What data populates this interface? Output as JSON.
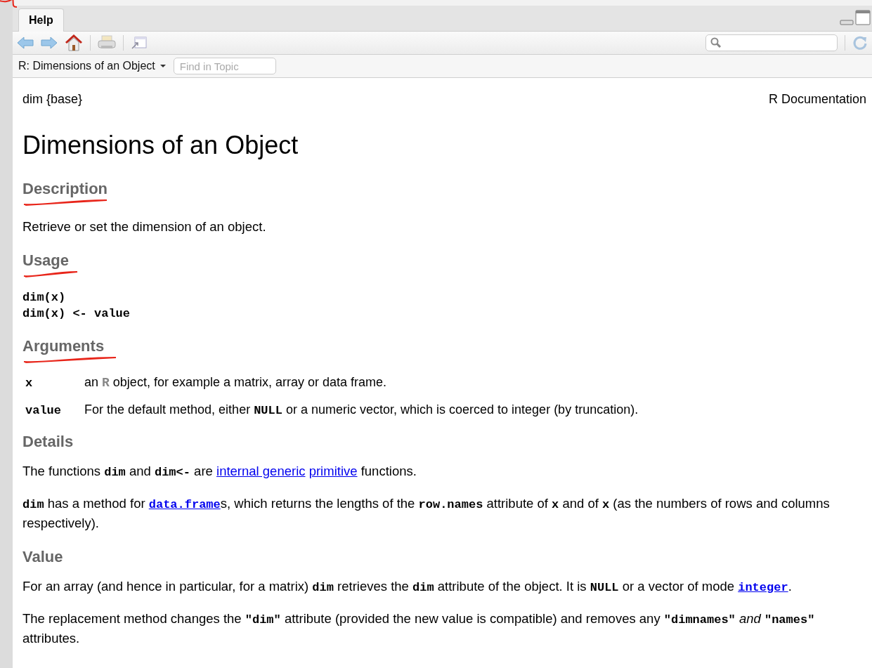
{
  "tab": {
    "label": "Help",
    "selected": true,
    "marked": true
  },
  "topic_bar": {
    "topic": "R: Dimensions of an Object",
    "find": {
      "placeholder": "Find in Topic"
    }
  },
  "doc": {
    "package": "dim {base}",
    "source": "R Documentation",
    "title": "Dimensions of an Object",
    "sections": [
      {
        "kind": "paragraphs",
        "heading": "Description",
        "marked": true,
        "paragraphs": [
          [
            {
              "kind": "text",
              "text": "Retrieve or set the dimension of an object."
            }
          ]
        ]
      },
      {
        "kind": "code",
        "heading": "Usage",
        "marked": true,
        "lines": [
          "dim(x)",
          "dim(x) <- value"
        ]
      },
      {
        "kind": "arguments",
        "heading": "Arguments",
        "marked": true,
        "rows": [
          {
            "name": "x",
            "desc": [
              {
                "kind": "text",
                "text": "an "
              },
              {
                "kind": "rlogo",
                "text": "R"
              },
              {
                "kind": "text",
                "text": " object, for example a matrix, array or data frame."
              }
            ]
          },
          {
            "name": "value",
            "desc": [
              {
                "kind": "text",
                "text": "For the default method, either "
              },
              {
                "kind": "code",
                "text": "NULL"
              },
              {
                "kind": "text",
                "text": " or a numeric vector, which is coerced to integer (by truncation)."
              }
            ]
          }
        ]
      },
      {
        "kind": "paragraphs",
        "heading": "Details",
        "marked": false,
        "paragraphs": [
          [
            {
              "kind": "text",
              "text": "The functions "
            },
            {
              "kind": "code",
              "text": "dim"
            },
            {
              "kind": "text",
              "text": " and "
            },
            {
              "kind": "code",
              "text": "dim<-"
            },
            {
              "kind": "text",
              "text": " are "
            },
            {
              "kind": "link",
              "text": "internal generic"
            },
            {
              "kind": "link",
              "text": " primitive"
            },
            {
              "kind": "text",
              "text": " functions."
            }
          ],
          [
            {
              "kind": "code",
              "text": "dim"
            },
            {
              "kind": "text",
              "text": " has a method for "
            },
            {
              "kind": "codelink",
              "text": "data.frame"
            },
            {
              "kind": "text",
              "text": "s, which returns the lengths of the "
            },
            {
              "kind": "code",
              "text": "row.names"
            },
            {
              "kind": "text",
              "text": " attribute of "
            },
            {
              "kind": "code",
              "text": "x"
            },
            {
              "kind": "text",
              "text": " and of "
            },
            {
              "kind": "code",
              "text": "x"
            },
            {
              "kind": "text",
              "text": " (as the numbers of rows and columns respectively)."
            }
          ]
        ]
      },
      {
        "kind": "paragraphs",
        "heading": "Value",
        "marked": false,
        "paragraphs": [
          [
            {
              "kind": "text",
              "text": "For an array (and hence in particular, for a matrix) "
            },
            {
              "kind": "code",
              "text": "dim"
            },
            {
              "kind": "text",
              "text": " retrieves the "
            },
            {
              "kind": "code",
              "text": "dim"
            },
            {
              "kind": "text",
              "text": " attribute of the object. It is "
            },
            {
              "kind": "code",
              "text": "NULL"
            },
            {
              "kind": "text",
              "text": " or a vector of mode "
            },
            {
              "kind": "codelink",
              "text": "integer"
            },
            {
              "kind": "text",
              "text": "."
            }
          ],
          [
            {
              "kind": "text",
              "text": "The replacement method changes the "
            },
            {
              "kind": "code",
              "text": "\"dim\""
            },
            {
              "kind": "text",
              "text": " attribute (provided the new value is compatible) and removes any "
            },
            {
              "kind": "code",
              "text": "\"dimnames\""
            },
            {
              "kind": "italic",
              "text": " and "
            },
            {
              "kind": "code",
              "text": "\"names\""
            },
            {
              "kind": "text",
              "text": " attributes."
            }
          ]
        ]
      }
    ]
  }
}
